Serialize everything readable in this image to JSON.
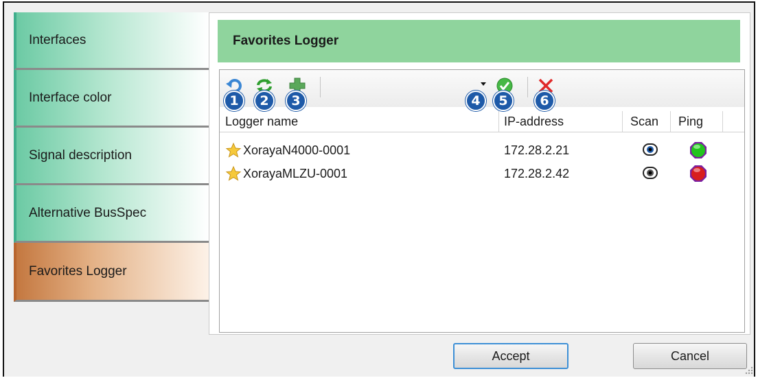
{
  "sidebar": {
    "items": [
      {
        "label": "Interfaces"
      },
      {
        "label": "Interface color"
      },
      {
        "label": "Signal description"
      },
      {
        "label": "Alternative BusSpec"
      },
      {
        "label": "Favorites Logger",
        "active": true
      }
    ]
  },
  "panel": {
    "title": "Favorites Logger",
    "toolbar": {
      "badges": [
        "1",
        "2",
        "3",
        "4",
        "5",
        "6"
      ],
      "icons": [
        "undo-icon",
        "refresh-icon",
        "add-icon",
        "dropdown-arrow-icon",
        "check-icon",
        "delete-icon"
      ]
    },
    "columns": [
      "Logger name",
      "IP-address",
      "Scan",
      "Ping"
    ],
    "rows": [
      {
        "name": "XorayaN4000-0001",
        "ip": "172.28.2.21",
        "scan_icon": "eye-icon",
        "ping_status": "online",
        "ping_color": "#22c41e"
      },
      {
        "name": "XorayaMLZU-0001",
        "ip": "172.28.2.42",
        "scan_icon": "eye-icon",
        "ping_status": "offline",
        "ping_color": "#d81e1e"
      }
    ]
  },
  "buttons": {
    "accept": "Accept",
    "cancel": "Cancel"
  },
  "colors": {
    "header_bg": "#8fd49d",
    "tab_green": "#6ccaa4",
    "tab_active": "#c47840",
    "badge": "#1e5aa8",
    "accept_border": "#3c8fd6"
  }
}
